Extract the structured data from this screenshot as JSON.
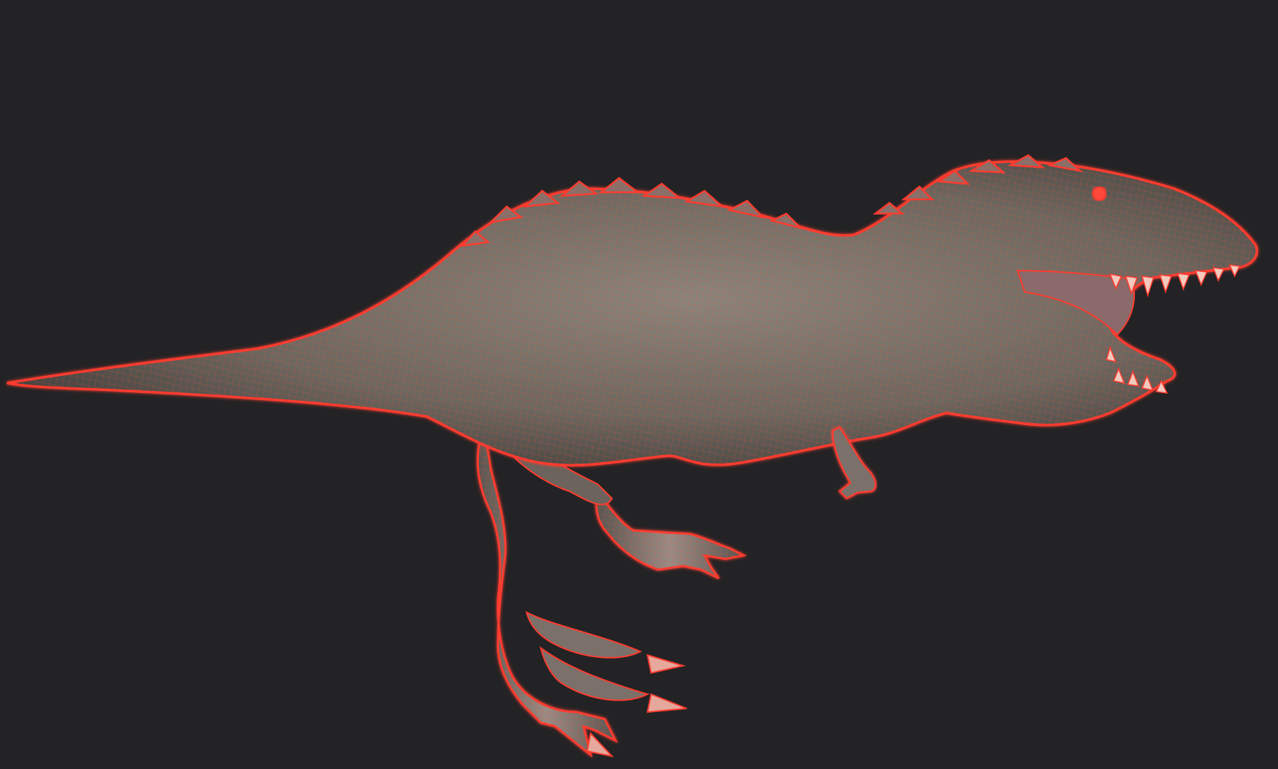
{
  "viewport": {
    "background": "#232325"
  },
  "model": {
    "subject": "tyrannosaurus-wireframe-mesh",
    "render_mode": "wireframe-on-shaded",
    "wire_color": "#ff3b2f",
    "skin_color": "#7d766d",
    "skin_dark": "#3f3d3a",
    "claw_color": "#e6a89b"
  }
}
